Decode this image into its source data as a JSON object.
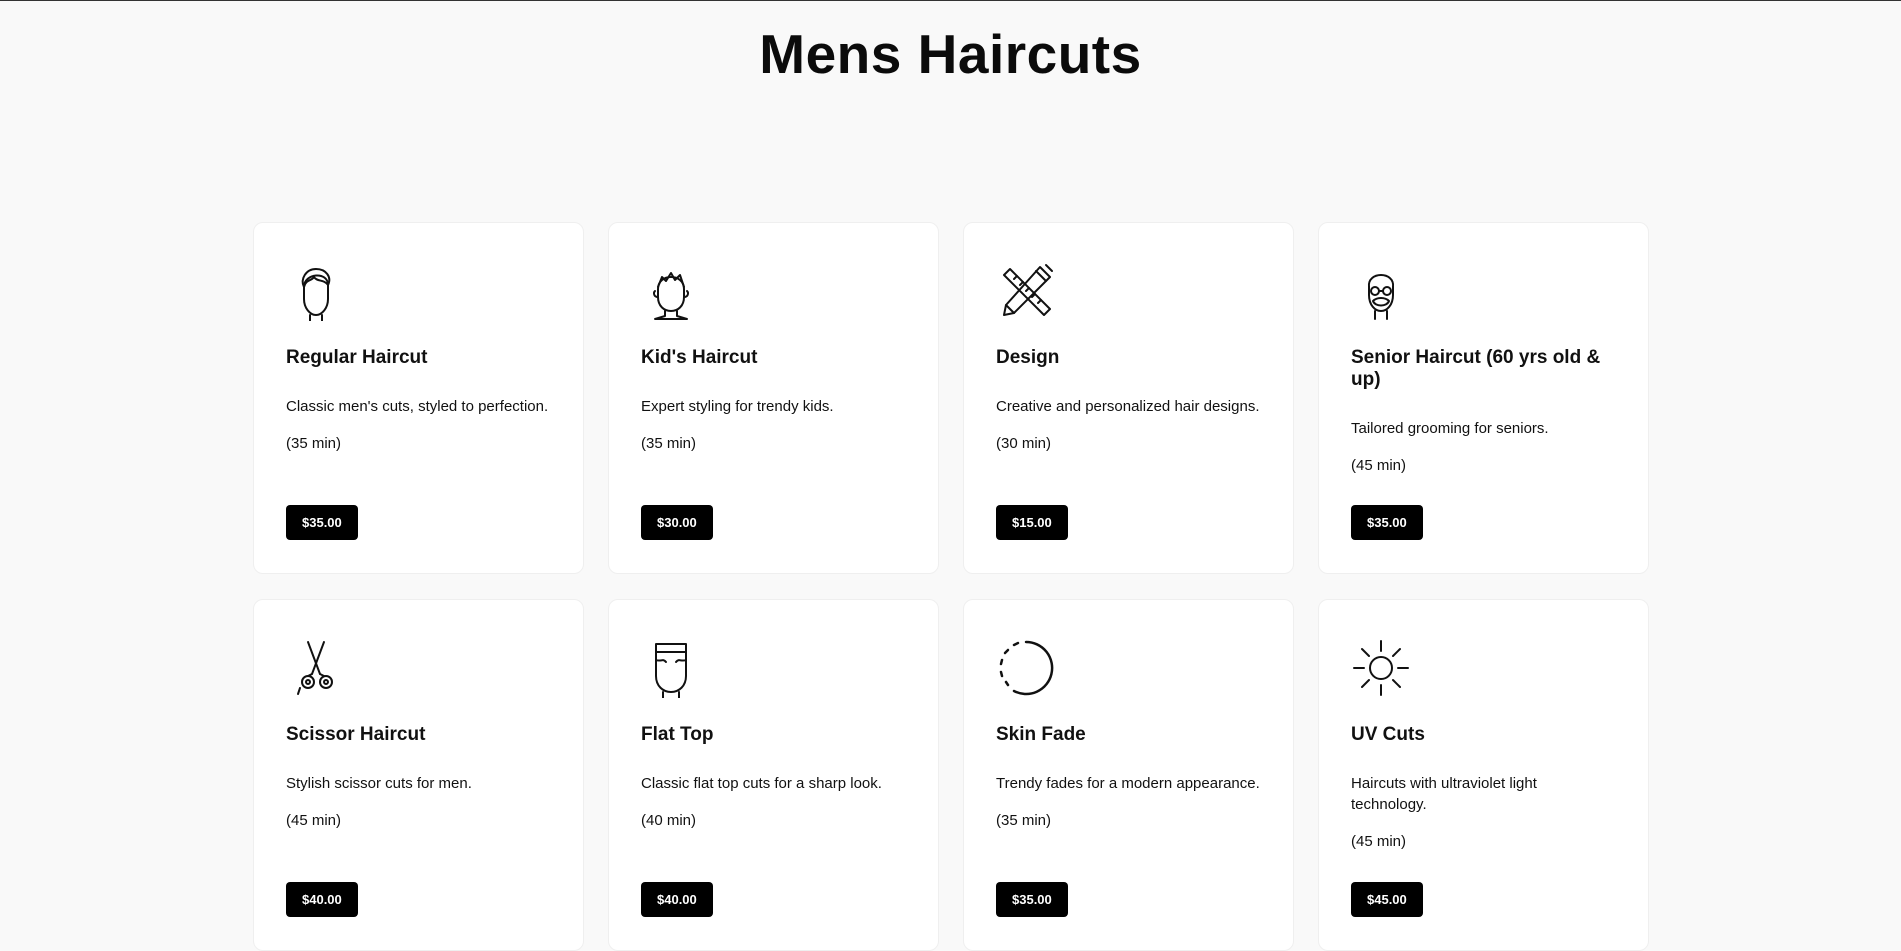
{
  "page": {
    "title": "Mens Haircuts"
  },
  "services": [
    {
      "icon": "man-head-icon",
      "title": "Regular Haircut",
      "description": "Classic men's cuts, styled to perfection.",
      "duration": "(35 min)",
      "price": "$35.00"
    },
    {
      "icon": "kid-head-icon",
      "title": "Kid's Haircut",
      "description": "Expert styling for trendy kids.",
      "duration": "(35 min)",
      "price": "$30.00"
    },
    {
      "icon": "ruler-pencil-icon",
      "title": "Design",
      "description": "Creative and personalized hair designs.",
      "duration": "(30 min)",
      "price": "$15.00"
    },
    {
      "icon": "senior-head-icon",
      "title": "Senior Haircut (60 yrs old & up)",
      "description": "Tailored grooming for seniors.",
      "duration": "(45 min)",
      "price": "$35.00"
    },
    {
      "icon": "scissors-icon",
      "title": "Scissor Haircut",
      "description": "Stylish scissor cuts for men.",
      "duration": "(45 min)",
      "price": "$40.00"
    },
    {
      "icon": "flat-top-head-icon",
      "title": "Flat Top",
      "description": "Classic flat top cuts for a sharp look.",
      "duration": "(40 min)",
      "price": "$40.00"
    },
    {
      "icon": "circle-fade-icon",
      "title": "Skin Fade",
      "description": "Trendy fades for a modern appearance.",
      "duration": "(35 min)",
      "price": "$35.00"
    },
    {
      "icon": "sun-icon",
      "title": "UV Cuts",
      "description": "Haircuts with ultraviolet light technology.",
      "duration": "(45 min)",
      "price": "$45.00"
    }
  ],
  "colors": {
    "background": "#f9f9f9",
    "card": "#ffffff",
    "button": "#000000",
    "button_text": "#ffffff"
  }
}
